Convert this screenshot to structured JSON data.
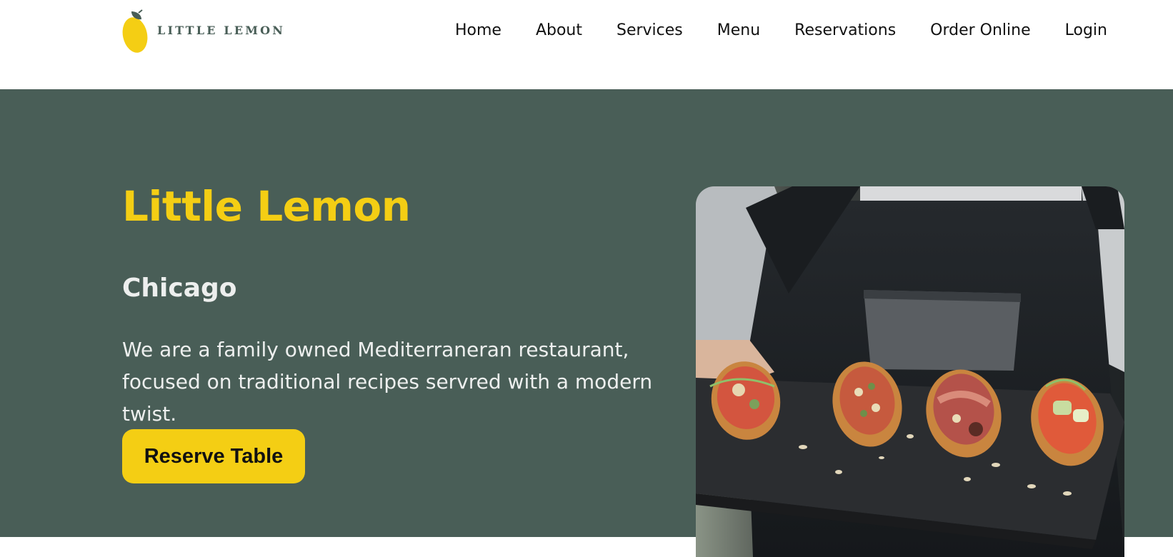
{
  "brand": {
    "logo_text": "LITTLE LEMON",
    "logo_icon": "lemon-icon"
  },
  "nav": {
    "items": [
      {
        "label": "Home"
      },
      {
        "label": "About"
      },
      {
        "label": "Services"
      },
      {
        "label": "Menu"
      },
      {
        "label": "Reservations"
      },
      {
        "label": "Order Online"
      },
      {
        "label": "Login"
      }
    ]
  },
  "hero": {
    "title": "Little Lemon",
    "city": "Chicago",
    "description": "We are a family owned Mediterraneran restaurant, focused on traditional recipes servred with a modern twist.",
    "reserve_label": "Reserve Table",
    "image_subject": "chef holding slate tray of bruschetta"
  },
  "colors": {
    "primary_green": "#495e57",
    "primary_yellow": "#f4ce14",
    "light_text": "#edefee",
    "white": "#ffffff"
  }
}
